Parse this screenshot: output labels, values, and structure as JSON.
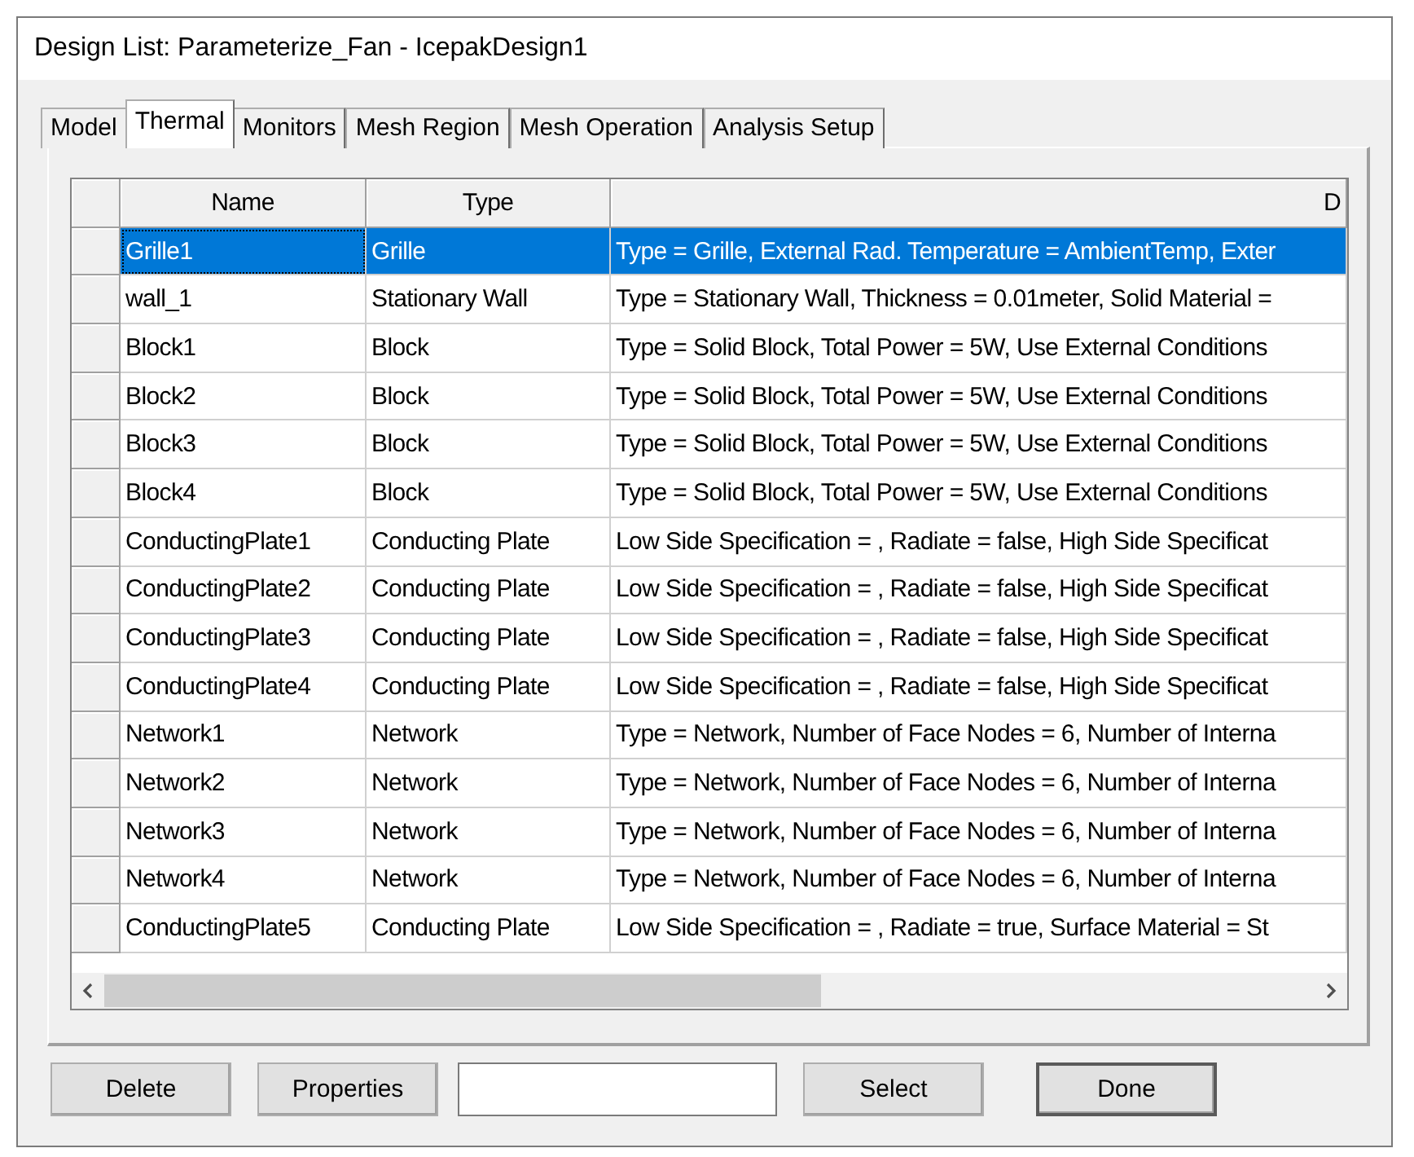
{
  "window": {
    "title": "Design List: Parameterize_Fan - IcepakDesign1"
  },
  "tabs": [
    {
      "label": "Model",
      "selected": false
    },
    {
      "label": "Thermal",
      "selected": true
    },
    {
      "label": "Monitors",
      "selected": false
    },
    {
      "label": "Mesh Region",
      "selected": false
    },
    {
      "label": "Mesh Operation",
      "selected": false
    },
    {
      "label": "Analysis Setup",
      "selected": false
    }
  ],
  "table": {
    "columns": [
      "Name",
      "Type",
      "D"
    ],
    "rows": [
      {
        "name": "Grille1",
        "type": "Grille",
        "column_3": "Type = Grille, External Rad. Temperature = AmbientTemp, Exter",
        "selected": true
      },
      {
        "name": "wall_1",
        "type": "Stationary Wall",
        "column_3": "Type = Stationary Wall, Thickness = 0.01meter, Solid Material =",
        "selected": false
      },
      {
        "name": "Block1",
        "type": "Block",
        "column_3": "Type = Solid Block, Total Power = 5W, Use External Conditions",
        "selected": false
      },
      {
        "name": "Block2",
        "type": "Block",
        "column_3": "Type = Solid Block, Total Power = 5W, Use External Conditions",
        "selected": false
      },
      {
        "name": "Block3",
        "type": "Block",
        "column_3": "Type = Solid Block, Total Power = 5W, Use External Conditions",
        "selected": false
      },
      {
        "name": "Block4",
        "type": "Block",
        "column_3": "Type = Solid Block, Total Power = 5W, Use External Conditions",
        "selected": false
      },
      {
        "name": "ConductingPlate1",
        "type": "Conducting Plate",
        "column_3": "Low Side Specification = , Radiate = false, High Side Specificat",
        "selected": false
      },
      {
        "name": "ConductingPlate2",
        "type": "Conducting Plate",
        "column_3": "Low Side Specification = , Radiate = false, High Side Specificat",
        "selected": false
      },
      {
        "name": "ConductingPlate3",
        "type": "Conducting Plate",
        "column_3": "Low Side Specification = , Radiate = false, High Side Specificat",
        "selected": false
      },
      {
        "name": "ConductingPlate4",
        "type": "Conducting Plate",
        "column_3": "Low Side Specification = , Radiate = false, High Side Specificat",
        "selected": false
      },
      {
        "name": "Network1",
        "type": "Network",
        "column_3": "Type = Network, Number of Face Nodes = 6, Number of Interna",
        "selected": false
      },
      {
        "name": "Network2",
        "type": "Network",
        "column_3": "Type = Network, Number of Face Nodes = 6, Number of Interna",
        "selected": false
      },
      {
        "name": "Network3",
        "type": "Network",
        "column_3": "Type = Network, Number of Face Nodes = 6, Number of Interna",
        "selected": false
      },
      {
        "name": "Network4",
        "type": "Network",
        "column_3": "Type = Network, Number of Face Nodes = 6, Number of Interna",
        "selected": false
      },
      {
        "name": "ConductingPlate5",
        "type": "Conducting Plate",
        "column_3": "Low Side Specification = , Radiate = true, Surface Material = St",
        "selected": false
      }
    ]
  },
  "buttons": [
    {
      "kind": "button",
      "label": "Delete"
    },
    {
      "kind": "button",
      "label": "Properties"
    },
    {
      "kind": "field"
    },
    {
      "kind": "button",
      "label": "Select"
    },
    {
      "kind": "default",
      "label": "Done"
    }
  ]
}
